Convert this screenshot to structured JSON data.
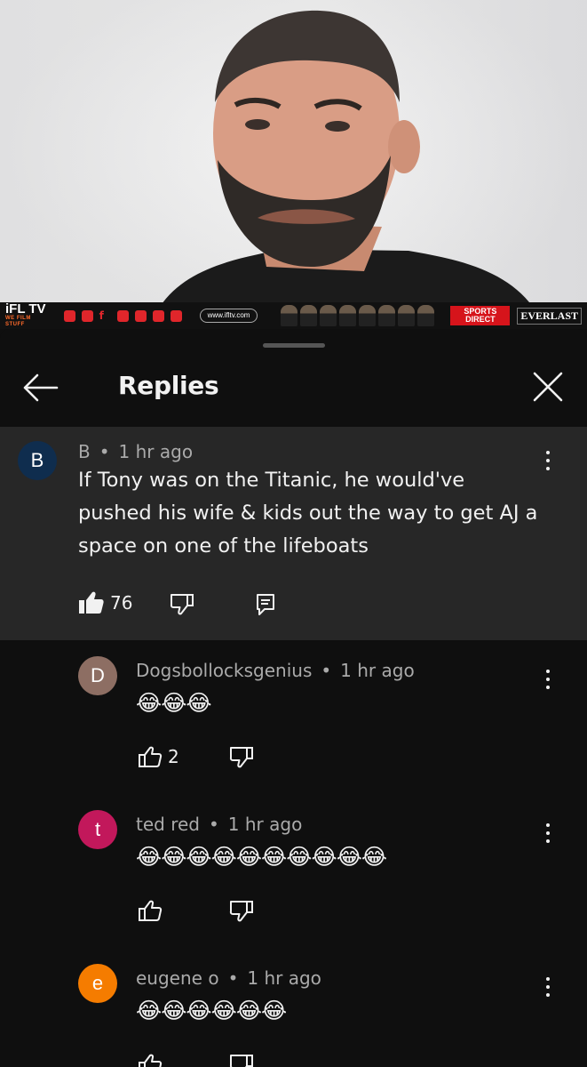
{
  "video": {
    "brand_logo": "iFL TV",
    "brand_tagline": "WE FILM STUFF",
    "url": "www.ifltv.com",
    "sponsor_1": "SPORTS DIRECT",
    "sponsor_2": "EVERLAST"
  },
  "header": {
    "title": "Replies",
    "back_icon": "arrow-left-icon",
    "close_icon": "close-icon"
  },
  "parent_comment": {
    "avatar_letter": "B",
    "avatar_color": "#0f2d4e",
    "author": "B",
    "time": "1 hr ago",
    "text": "If Tony was on the Titanic, he would've pushed his wife & kids out the way to get AJ a space on one of the lifeboats",
    "likes": "76"
  },
  "replies": [
    {
      "avatar_letter": "D",
      "avatar_color": "#8d6e63",
      "author": "Dogsbollocksgenius",
      "time": "1 hr ago",
      "text": "😂😂😂",
      "likes": "2"
    },
    {
      "avatar_letter": "t",
      "avatar_color": "#c2185b",
      "author": "ted red",
      "time": "1 hr ago",
      "text": "😂😂😂😂😂😂😂😂😂😂",
      "likes": ""
    },
    {
      "avatar_letter": "e",
      "avatar_color": "#f57c00",
      "author": "eugene o",
      "time": "1 hr ago",
      "text": "😂😂😂😂😂😂",
      "likes": ""
    }
  ],
  "separator": "•"
}
